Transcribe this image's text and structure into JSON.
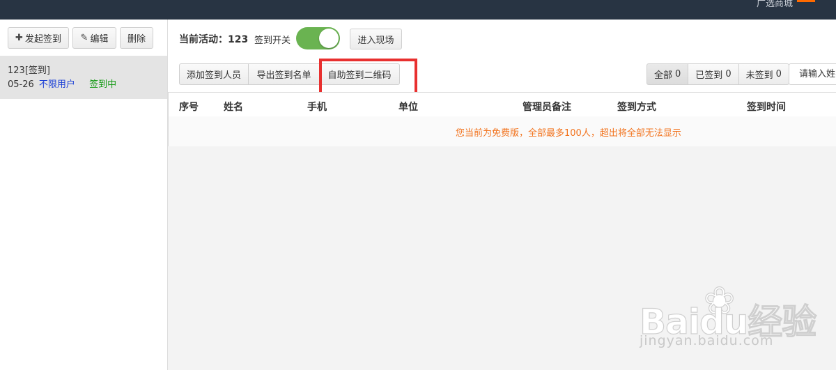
{
  "topbar": {
    "store_label": "广选商城"
  },
  "sidebar": {
    "toolbar": {
      "start_label": "发起签到",
      "edit_label": "编辑",
      "delete_label": "删除"
    },
    "items": [
      {
        "title": "123[签到]",
        "date": "05-26",
        "users": "不限用户",
        "status": "签到中"
      }
    ]
  },
  "header": {
    "current_activity_label": "当前活动：",
    "current_activity_value": "123",
    "switch_label": "签到开关",
    "switch_on": true,
    "enter_scene_label": "进入现场"
  },
  "actions": {
    "add_attendee_label": "添加签到人员",
    "export_list_label": "导出签到名单",
    "qr_code_label": "自助签到二维码"
  },
  "filters": [
    {
      "label": "全部",
      "count": "0"
    },
    {
      "label": "已签到",
      "count": "0"
    },
    {
      "label": "未签到",
      "count": "0"
    }
  ],
  "search": {
    "placeholder": "请输入姓名"
  },
  "table": {
    "columns": [
      "序号",
      "姓名",
      "手机",
      "单位",
      "管理员备注",
      "签到方式",
      "签到时间"
    ],
    "notice": "您当前为免费版，全部最多100人，超出将全部无法显示"
  },
  "watermark": {
    "brand": "Baidu经验",
    "url": "jingyan.baidu.com"
  },
  "colors": {
    "topbar": "#283443",
    "toggle_on": "#6ab351",
    "highlight": "#e8302f",
    "notice": "#f2721c",
    "users_link": "#1a3fd6",
    "status_green": "#139a13"
  }
}
